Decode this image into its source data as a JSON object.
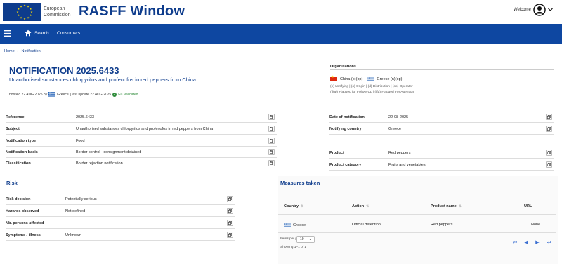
{
  "header": {
    "org_line1": "European",
    "org_line2": "Commission",
    "app_title": "RASFF Window",
    "welcome": "Welcome"
  },
  "nav": {
    "search": "Search",
    "consumers": "Consumers"
  },
  "breadcrumb": [
    "Home",
    "Notification"
  ],
  "notification": {
    "title": "NOTIFICATION 2025.6433",
    "subtitle": "Unauthorised substances chlorpyrifos and profenofos in red peppers from China",
    "meta_notified": "notified 22 AUG 2025 by",
    "meta_country": "Greece",
    "meta_update": "| last update 22 AUG 2025",
    "meta_validated": "EC validated"
  },
  "organisations": {
    "heading": "Organisations",
    "items": [
      {
        "name": "China (o)(op)",
        "flag": "cn"
      },
      {
        "name": "Greece (n)(op)",
        "flag": "gr"
      }
    ],
    "legend1": "(n) Notifying | (o) Origin | (d) Distribution | (op) Operator",
    "legend2": "(ffup) Flagged for Follow-Up | (ffa) Flagged For Attention"
  },
  "fields_left": [
    {
      "label": "Reference",
      "value": "2025.6433"
    },
    {
      "label": "Subject",
      "value": "Unauthorised substances chlorpyrifos and profenofos in red peppers from China"
    },
    {
      "label": "Notification type",
      "value": "Food"
    },
    {
      "label": "Notification basis",
      "value": "Border control - consignment detained"
    },
    {
      "label": "Classification",
      "value": "Border rejection notification"
    }
  ],
  "fields_right_top": [
    {
      "label": "Date of notification",
      "value": "22-08-2025"
    },
    {
      "label": "Notifying country",
      "value": "Greece"
    }
  ],
  "fields_right_bottom": [
    {
      "label": "Product",
      "value": "Red peppers"
    },
    {
      "label": "Product category",
      "value": "Fruits and vegetables"
    }
  ],
  "risk": {
    "title": "Risk",
    "rows": [
      {
        "label": "Risk decision",
        "value": "Potentially serious"
      },
      {
        "label": "Hazards observed",
        "value": "Not defined"
      },
      {
        "label": "Nb. persons affected",
        "value": "---"
      },
      {
        "label": "Symptoms / illness",
        "value": "Unknown"
      }
    ]
  },
  "measures": {
    "title": "Measures taken",
    "columns": [
      "Country",
      "Action",
      "Product name",
      "URL"
    ],
    "rows": [
      {
        "country": "Greece",
        "action": "Official detention",
        "product": "Red peppers",
        "url": "None"
      }
    ],
    "items_per_page_label": "Items per page:",
    "items_per_page_value": "10",
    "showing": "Showing 1–1 of 1"
  },
  "colors": {
    "brand_blue": "#0e3c8c",
    "navbar_blue": "#0e47a1",
    "validated_green": "#2e8b3a",
    "pager_blue": "#3b6fd1"
  }
}
